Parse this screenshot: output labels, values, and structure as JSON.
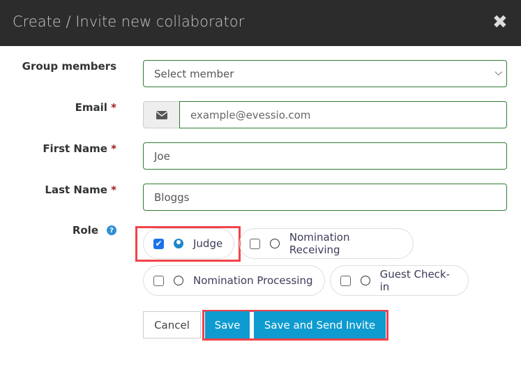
{
  "header": {
    "title": "Create / Invite new collaborator",
    "close_icon": "close-icon"
  },
  "form": {
    "group_members": {
      "label": "Group members",
      "value": "Select member"
    },
    "email": {
      "label": "Email",
      "required": "*",
      "placeholder": "example@evessio.com"
    },
    "first_name": {
      "label": "First Name",
      "required": "*",
      "value": "Joe"
    },
    "last_name": {
      "label": "Last Name",
      "required": "*",
      "value": "Bloggs"
    },
    "role": {
      "label": "Role",
      "help": "?",
      "options": [
        {
          "label": "Judge",
          "checked": true
        },
        {
          "label": "Nomination Receiving",
          "checked": false
        },
        {
          "label": "Nomination Processing",
          "checked": false
        },
        {
          "label": "Guest Check-in",
          "checked": false
        }
      ]
    }
  },
  "buttons": {
    "cancel": "Cancel",
    "save": "Save",
    "save_invite": "Save and Send Invite"
  },
  "colors": {
    "header": "#2c2c2c",
    "primary": "#0e9bd0",
    "highlight": "#f0434a",
    "input_border": "#2e7d32"
  }
}
